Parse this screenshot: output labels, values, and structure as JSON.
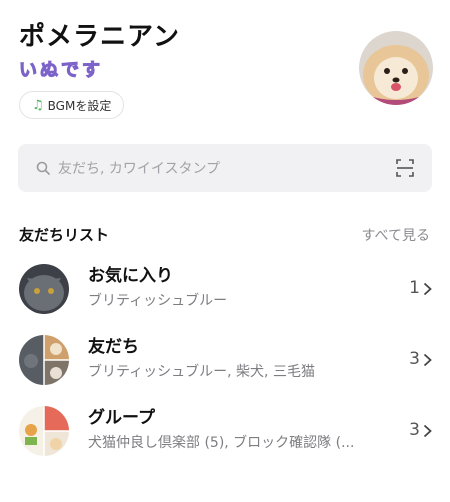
{
  "profile": {
    "name": "ポメラニアン",
    "status": "いぬです",
    "bgm_label": "BGMを設定"
  },
  "search": {
    "placeholder": "友だち, カワイイスタンプ"
  },
  "friends_section": {
    "title": "友だちリスト",
    "see_all": "すべて見る",
    "rows": [
      {
        "title": "お気に入り",
        "subtitle": "ブリティッシュブルー",
        "count": "1"
      },
      {
        "title": "友だち",
        "subtitle": "ブリティッシュブルー, 柴犬, 三毛猫",
        "count": "3"
      },
      {
        "title": "グループ",
        "subtitle": "犬猫仲良し倶楽部 (5), ブロック確認隊 (...",
        "count": "3"
      }
    ]
  },
  "colors": {
    "bgm_note": "#4cb35b",
    "search_bg": "#f1f1f3",
    "status_text": "#c7b6f2"
  },
  "icons": [
    "music-note-icon",
    "search-icon",
    "scan-icon",
    "chevron-right-icon"
  ]
}
